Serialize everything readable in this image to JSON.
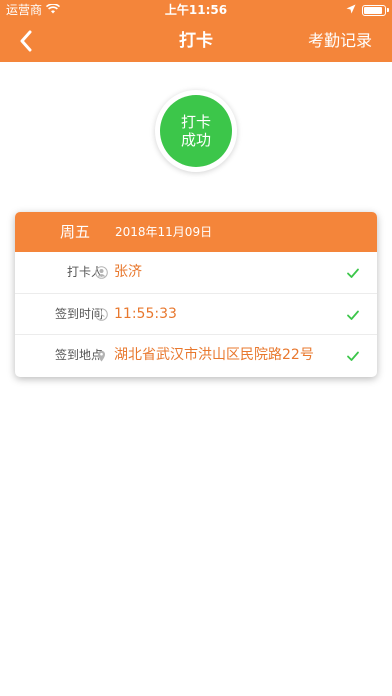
{
  "status_bar": {
    "carrier": "运营商",
    "time": "上午11:56"
  },
  "nav": {
    "title": "打卡",
    "right_action": "考勤记录",
    "back_icon": "chevron-left-icon"
  },
  "success": {
    "line1": "打卡",
    "line2": "成功"
  },
  "card": {
    "weekday": "周五",
    "date": "2018年11月09日",
    "rows": [
      {
        "label": "打卡人",
        "icon": "user-icon",
        "value": "张济",
        "status": "check-icon"
      },
      {
        "label": "签到时间",
        "icon": "clock-icon",
        "value": "11:55:33",
        "status": "check-icon"
      },
      {
        "label": "签到地点",
        "icon": "location-pin-icon",
        "value": "湖北省武汉市洪山区民院路22号",
        "status": "check-icon"
      }
    ]
  },
  "colors": {
    "brand": "#f4853a",
    "success": "#3cc64a",
    "value_text": "#e8782e",
    "check": "#3cc64a"
  }
}
